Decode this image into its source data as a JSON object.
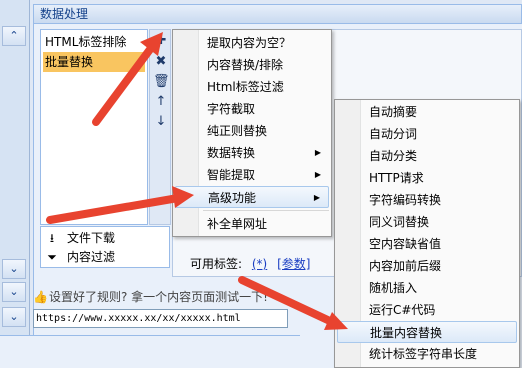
{
  "panel": {
    "title": "数据处理"
  },
  "left_strip": {
    "icons": [
      "chevron-up-icon",
      "chevron-down-icon",
      "chevron-down-icon",
      "chevron-down-icon"
    ]
  },
  "rules": [
    {
      "label": "HTML标签排除",
      "selected": false
    },
    {
      "label": "批量替换",
      "selected": true
    }
  ],
  "list_tools": [
    "plus-icon",
    "delete-icon",
    "trash-icon",
    "move-up-icon",
    "move-down-icon"
  ],
  "commands": [
    {
      "label": "文件下载",
      "icon": "download-icon"
    },
    {
      "label": "内容过滤",
      "icon": "filter-icon"
    }
  ],
  "available_tags": {
    "label": "可用标签:",
    "tag1": "(*)",
    "tag2": "[参数]"
  },
  "tip": "设置好了规则? 拿一个内容页面测试一下!",
  "url_value": "https://www.xxxxx.xx/xx/xxxxx.html",
  "menu_main": [
    {
      "label": "提取内容为空？",
      "submenu": false
    },
    {
      "label": "内容替换/排除",
      "submenu": false
    },
    {
      "label": "Html标签过滤",
      "submenu": false
    },
    {
      "label": "字符截取",
      "submenu": false
    },
    {
      "label": "纯正则替换",
      "submenu": false
    },
    {
      "label": "数据转换",
      "submenu": true
    },
    {
      "label": "智能提取",
      "submenu": true
    },
    {
      "label": "高级功能",
      "submenu": true,
      "highlighted": true
    },
    {
      "label": "补全单网址",
      "submenu": false
    }
  ],
  "menu_advanced": [
    {
      "label": "自动摘要"
    },
    {
      "label": "自动分词"
    },
    {
      "label": "自动分类"
    },
    {
      "label": "HTTP请求"
    },
    {
      "label": "字符编码转换"
    },
    {
      "label": "同义词替换"
    },
    {
      "label": "空内容缺省值"
    },
    {
      "label": "内容加前后缀"
    },
    {
      "label": "随机插入"
    },
    {
      "label": "运行C#代码"
    },
    {
      "label": "批量内容替换",
      "highlighted": true
    },
    {
      "label": "统计标签字符串长度"
    }
  ],
  "colors": {
    "arrow": "#e8432f",
    "selection": "#f9c560",
    "header_text": "#15428b"
  }
}
